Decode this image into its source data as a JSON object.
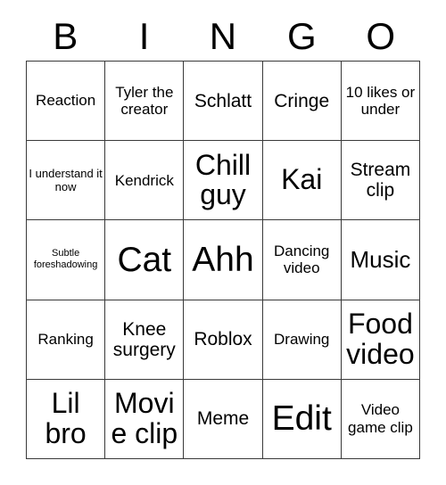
{
  "card": {
    "title": "BINGO",
    "header_letters": [
      "B",
      "I",
      "N",
      "G",
      "O"
    ],
    "border_color": "#3a3a3a",
    "background_color": "#ffffff",
    "text_color": "#000000",
    "rows": 5,
    "columns": 5,
    "grid": [
      [
        {
          "text": "Reaction",
          "size": "sm"
        },
        {
          "text": "Tyler the creator",
          "size": "sm"
        },
        {
          "text": "Schlatt",
          "size": "md"
        },
        {
          "text": "Cringe",
          "size": "md"
        },
        {
          "text": "10 likes or under",
          "size": "sm"
        }
      ],
      [
        {
          "text": "I understand it now",
          "size": "xs"
        },
        {
          "text": "Kendrick",
          "size": "sm"
        },
        {
          "text": "Chill guy",
          "size": "xl"
        },
        {
          "text": "Kai",
          "size": "xl"
        },
        {
          "text": "Stream clip",
          "size": "md"
        }
      ],
      [
        {
          "text": "Subtle foreshadowing",
          "size": "xxs"
        },
        {
          "text": "Cat",
          "size": "xxl"
        },
        {
          "text": "Ahh",
          "size": "xxl"
        },
        {
          "text": "Dancing video",
          "size": "sm"
        },
        {
          "text": "Music",
          "size": "lg"
        }
      ],
      [
        {
          "text": "Ranking",
          "size": "sm"
        },
        {
          "text": "Knee surgery",
          "size": "md"
        },
        {
          "text": "Roblox",
          "size": "md"
        },
        {
          "text": "Drawing",
          "size": "sm"
        },
        {
          "text": "Food video",
          "size": "xl"
        }
      ],
      [
        {
          "text": "Lil bro",
          "size": "xl"
        },
        {
          "text": "Movie clip",
          "size": "xl"
        },
        {
          "text": "Meme",
          "size": "md"
        },
        {
          "text": "Edit",
          "size": "xxl"
        },
        {
          "text": "Video game clip",
          "size": "sm"
        }
      ]
    ]
  }
}
